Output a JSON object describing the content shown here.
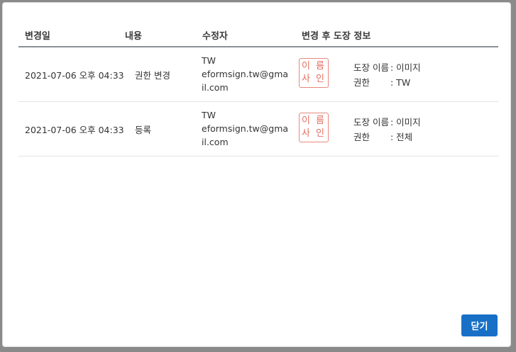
{
  "table": {
    "headers": {
      "date": "변경일",
      "content": "내용",
      "editor": "수정자",
      "stamp_info": "변경 후 도장 정보"
    },
    "rows": [
      {
        "date": "2021-07-06 오후 04:33",
        "content": "권한 변경",
        "editor_name": "TW",
        "editor_email": "eformsign.tw@gmail.com",
        "stamp_line1": "이 름",
        "stamp_line2": "사 인",
        "stamp_name_label": "도장 이름",
        "stamp_name_value": ": 이미지",
        "permission_label": "권한",
        "permission_value": ": TW"
      },
      {
        "date": "2021-07-06 오후 04:33",
        "content": "등록",
        "editor_name": "TW",
        "editor_email": "eformsign.tw@gmail.com",
        "stamp_line1": "이 름",
        "stamp_line2": "사 인",
        "stamp_name_label": "도장 이름",
        "stamp_name_value": ": 이미지",
        "permission_label": "권한",
        "permission_value": ": 전체"
      }
    ]
  },
  "footer": {
    "close_label": "닫기"
  },
  "colors": {
    "primary_button": "#1870c6",
    "stamp": "#e46d62"
  }
}
